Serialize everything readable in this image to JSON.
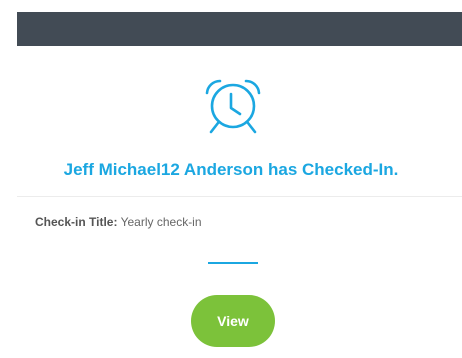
{
  "header": {
    "color": "#424b55"
  },
  "icon": {
    "name": "alarm-clock-icon",
    "color": "#1ba7e1"
  },
  "notification": {
    "headline": "Jeff Michael12 Anderson has Checked-In.",
    "headline_color": "#1ba7e1"
  },
  "checkin": {
    "title_label": "Check-in Title:",
    "title_value": "Yearly check-in"
  },
  "actions": {
    "view_label": "View",
    "view_color": "#7cc23a"
  }
}
